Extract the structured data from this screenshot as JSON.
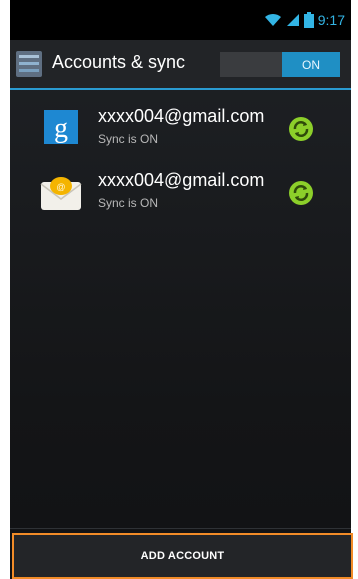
{
  "status_bar": {
    "time": "9:17",
    "icons": [
      "wifi-icon",
      "signal-icon",
      "battery-icon"
    ],
    "accent": "#33b5e5"
  },
  "action_bar": {
    "title": "Accounts & sync",
    "toggle_label": "ON",
    "accent": "#2a9bd1"
  },
  "accounts": [
    {
      "icon": "google-icon",
      "email": "xxxx004@gmail.com",
      "status": "Sync is ON",
      "sync_icon": "sync-icon"
    },
    {
      "icon": "email-app-icon",
      "email": "xxxx004@gmail.com",
      "status": "Sync is ON",
      "sync_icon": "sync-icon"
    }
  ],
  "footer": {
    "add_account_label": "ADD ACCOUNT",
    "highlight_color": "#f28c28"
  }
}
